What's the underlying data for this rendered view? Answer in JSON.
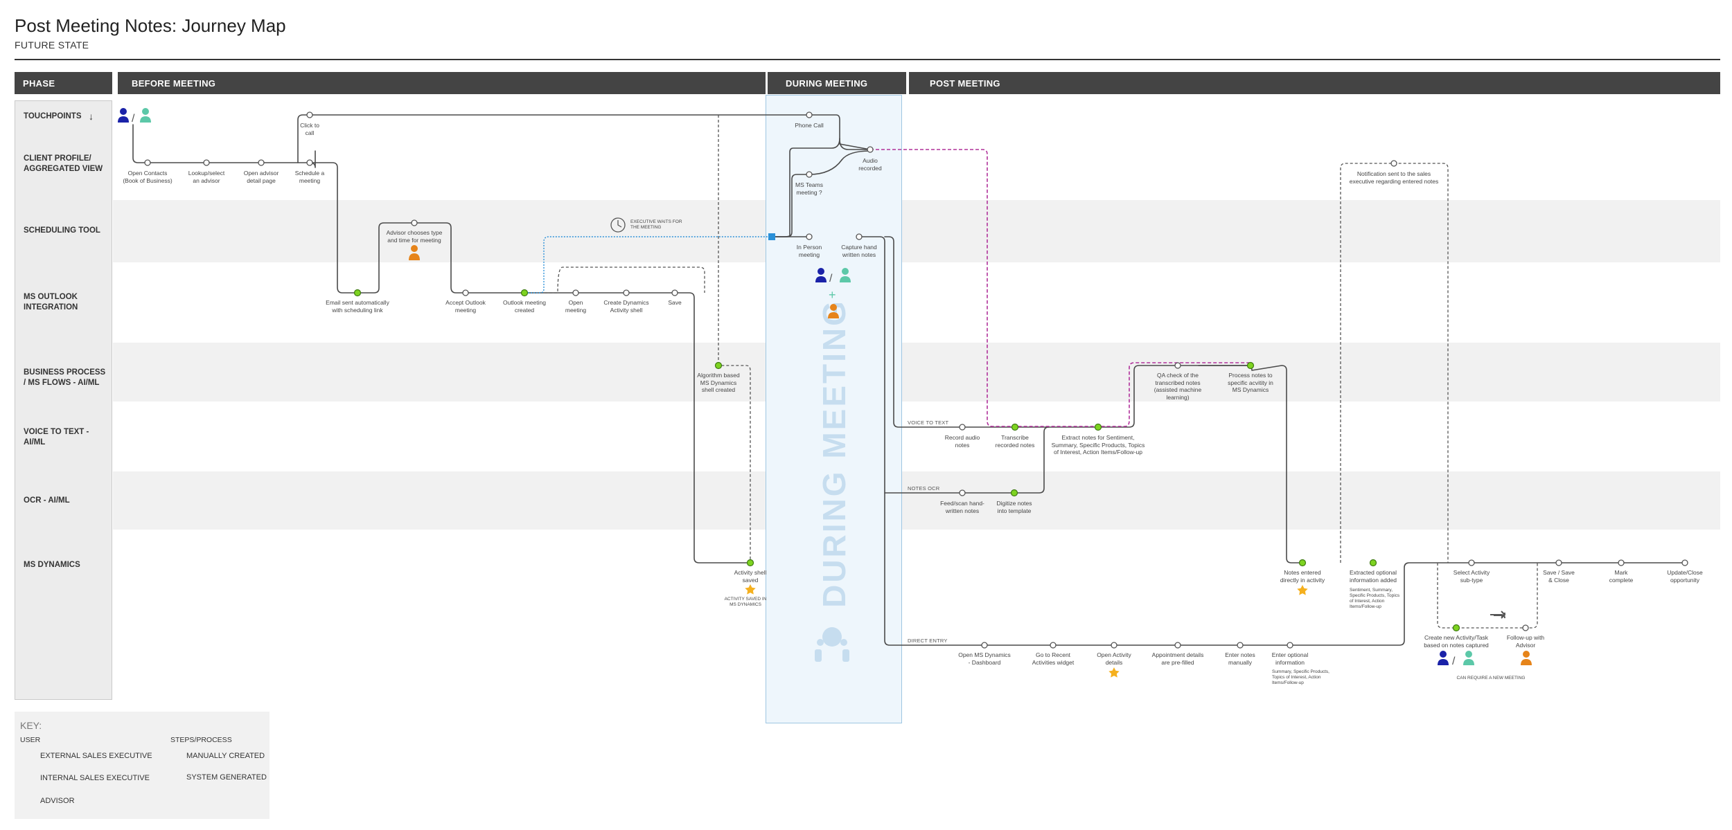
{
  "header": {
    "title": "Post Meeting Notes: Journey Map",
    "subtitle": "FUTURE STATE"
  },
  "phases": {
    "label": "PHASE",
    "items": [
      "BEFORE MEETING",
      "DURING MEETING",
      "POST MEETING"
    ]
  },
  "rows": [
    {
      "id": "touchpoints",
      "label": "TOUCHPOINTS"
    },
    {
      "id": "client-profile",
      "label": "CLIENT PROFILE/ AGGREGATED VIEW"
    },
    {
      "id": "scheduling-tool",
      "label": "SCHEDULING TOOL"
    },
    {
      "id": "ms-outlook",
      "label": "MS OUTLOOK INTEGRATION"
    },
    {
      "id": "business-process",
      "label": "BUSINESS PROCESS / MS FLOWS - AI/ML"
    },
    {
      "id": "voice-to-text",
      "label": "VOICE TO TEXT - AI/ML"
    },
    {
      "id": "ocr",
      "label": "OCR - AI/ML"
    },
    {
      "id": "ms-dynamics",
      "label": "MS DYNAMICS"
    }
  ],
  "during_meeting_vertical": "DURING MEETING",
  "steps": {
    "click_to_call": "Click to call",
    "open_contacts": "Open Contacts (Book of Business)",
    "lookup_advisor": "Lookup/select an advisor",
    "open_advisor_detail": "Open advisor detail page",
    "schedule_meeting": "Schedule a meeting",
    "advisor_chooses": "Advisor chooses type and time for meeting",
    "email_sent": "Email sent automatically with scheduling link",
    "accept_outlook": "Accept Outlook meeting",
    "outlook_created": "Outlook meeting created",
    "open_meeting": "Open meeting",
    "create_dynamics_shell": "Create Dynamics Activity shell",
    "save": "Save",
    "algorithm_shell": "Algorithm based MS Dynamics shell created",
    "activity_shell_saved": "Activity shell saved",
    "activity_saved_note": "ACTIVITY SAVED IN MS DYNAMICS",
    "executive_waits": "EXECUTIVE WAITS FOR THE MEETING",
    "phone_call": "Phone Call",
    "audio_recorded": "Audio recorded",
    "ms_teams": "MS Teams meeting ?",
    "in_person": "In Person meeting",
    "capture_hand": "Capture hand written notes",
    "record_audio": "Record audio notes",
    "transcribe_notes": "Transcribe recorded notes",
    "extract_notes": "Extract notes for Sentiment, Summary, Specific Products, Topics of Interest, Action Items/Follow-up",
    "qa_check": "QA check of the transcribed notes (assisted machine learning)",
    "process_notes": "Process notes to specific acvitity in MS Dynamics",
    "feed_scan": "Feed/scan hand-written notes",
    "digitize_notes": "Digitize notes into template",
    "notification_sent": "Notification sent to the sales executive regarding entered notes",
    "notes_entered": "Notes entered directly in activity",
    "extracted_optional": "Extracted optional information added",
    "extracted_optional_detail": "Sentiment, Summary, Specific Products, Topics of Interest, Action Items/Follow-up",
    "select_activity": "Select Activity sub-type",
    "save_close": "Save / Save & Close",
    "mark_complete": "Mark complete",
    "update_close": "Update/Close opportunity",
    "create_new_activity": "Create new Activity/Task based on notes captured",
    "follow_up_advisor": "Follow-up with Advisor",
    "can_require": "CAN REQUIRE A NEW MEETING",
    "open_ms_dynamics": "Open MS Dynamics - Dashboard",
    "go_recent": "Go to Recent Activities widget",
    "open_activity_details": "Open Activity details",
    "appointment_prefilled": "Appointment details are pre-filled",
    "enter_notes_manually": "Enter notes manually",
    "enter_optional": "Enter optional information",
    "enter_optional_detail": "Summary, Specific Products, Topics of Interest, Action Items/Follow-up"
  },
  "segment_labels": {
    "voice_to_text": "VOICE TO TEXT",
    "notes_ocr": "NOTES OCR",
    "direct_entry": "DIRECT ENTRY"
  },
  "key": {
    "title": "KEY:",
    "user_heading": "USER",
    "external": "EXTERNAL SALES EXECUTIVE",
    "internal": "INTERNAL SALES EXECUTIVE",
    "advisor": "ADVISOR",
    "steps_heading": "STEPS/PROCESS",
    "manual": "MANUALLY CREATED",
    "system": "SYSTEM GENERATED"
  },
  "colors": {
    "external_user": "#1a22a8",
    "internal_user": "#5cc8a8",
    "advisor": "#e6841a",
    "system_node": "#7ed321",
    "process_line": "#4a4a4a",
    "magenta_path": "#b0309a",
    "blue_path": "#2a90d8",
    "star": "#f5b01e"
  }
}
